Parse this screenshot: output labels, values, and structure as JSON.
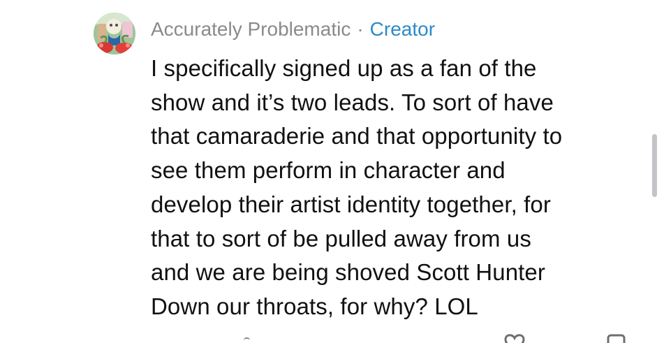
{
  "comment": {
    "author": "Accurately Problematic",
    "separator": "·",
    "role": "Creator",
    "lines": [
      "I specifically signed up as a fan of the",
      "show and it’s two leads. To sort of have",
      "that camaraderie and that opportunity to",
      "see them perform in character and",
      "develop their artist identity together, for",
      "that to sort of be pulled away from us",
      "and we are being shoved Scott Hunter",
      "Down our throats, for why? LOL"
    ]
  },
  "icons": {
    "avatar": "profile-avatar",
    "like": "heart-icon",
    "reply": "reply-icon"
  },
  "colors": {
    "text": "#111111",
    "muted": "#8a8a8f",
    "accent": "#2c8ac8",
    "background": "#ffffff"
  }
}
